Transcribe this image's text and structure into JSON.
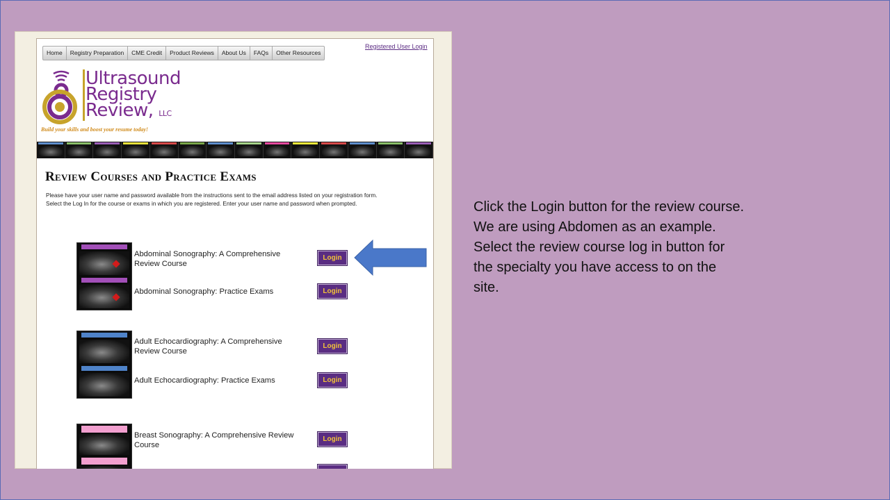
{
  "nav": {
    "items": [
      "Home",
      "Registry Preparation",
      "CME Credit",
      "Product Reviews",
      "About Us",
      "FAQs",
      "Other Resources"
    ],
    "registered_login": "Registered User Login"
  },
  "logo": {
    "line1": "Ultrasound",
    "line2": "Registry",
    "line3": "Review,",
    "llc": "LLC",
    "tagline": "Build your skills and boost your resume today!"
  },
  "page": {
    "heading": "Review Courses and Practice Exams",
    "intro_line1": "Please have your user name and password available from the instructions sent to the email address listed on your registration form.",
    "intro_line2": "Select the Log In for the course or exams in which you are registered.  Enter your user name and password when prompted."
  },
  "courses": [
    {
      "title": "Abdominal Sonography: A Comprehensive Review Course",
      "button": "Login"
    },
    {
      "title": "Abdominal Sonography: Practice Exams",
      "button": "Login"
    },
    {
      "title": "Adult Echocardiography: A Comprehensive Review Course",
      "button": "Login"
    },
    {
      "title": "Adult Echocardiography: Practice Exams",
      "button": "Login"
    },
    {
      "title": "Breast Sonography: A Comprehensive Review Course",
      "button": "Login"
    }
  ],
  "instructions": "Click the Login button for the review course. We are using Abdomen as an example. Select the review course log in button for the specialty you have access to on the site.",
  "colors": {
    "slide_bg": "#bf9cbf",
    "button_bg": "#5a2d82",
    "button_text": "#f2c23a",
    "arrow": "#4a78c9",
    "brand_purple": "#7a2b8e"
  }
}
